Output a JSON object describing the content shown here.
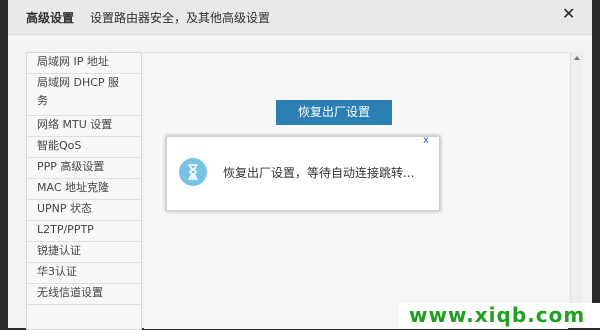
{
  "header": {
    "title": "高级设置",
    "subtitle": "设置路由器安全，及其他高级设置"
  },
  "sidebar": {
    "items": [
      {
        "label": "局域网 IP 地址"
      },
      {
        "label_line1": "局域网 DHCP 服",
        "label_line2": "务"
      },
      {
        "label": "网络 MTU 设置"
      },
      {
        "label": "智能QoS"
      },
      {
        "label": "PPP 高级设置"
      },
      {
        "label": "MAC 地址克隆"
      },
      {
        "label": "UPNP 状态"
      },
      {
        "label": "L2TP/PPTP"
      },
      {
        "label": "锐捷认证"
      },
      {
        "label": "华3认证"
      },
      {
        "label": "无线信道设置"
      }
    ]
  },
  "main": {
    "reset_button_label": "恢复出厂设置"
  },
  "dialog": {
    "message": "恢复出厂设置，等待自动连接跳转...",
    "close_label": "x",
    "icon": "hourglass-icon"
  },
  "window": {
    "close_label": "✕"
  },
  "watermark": {
    "text": "www.xiqb.com"
  }
}
